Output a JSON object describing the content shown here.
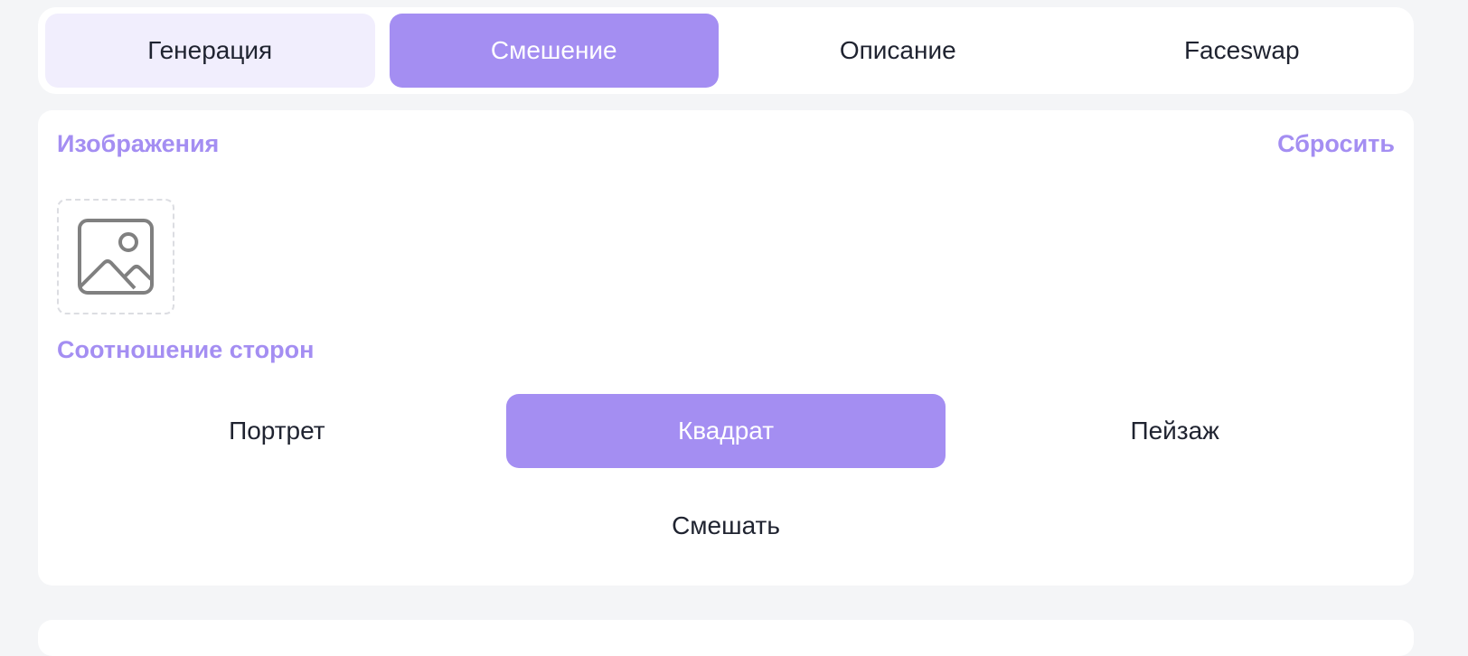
{
  "tabs": [
    {
      "label": "Генерация",
      "state": "light"
    },
    {
      "label": "Смешение",
      "state": "active"
    },
    {
      "label": "Описание",
      "state": "normal"
    },
    {
      "label": "Faceswap",
      "state": "normal"
    }
  ],
  "images": {
    "label": "Изображения",
    "reset_label": "Сбросить",
    "slot_icon": "image-placeholder-icon"
  },
  "aspect": {
    "label": "Соотношение сторон",
    "options": [
      {
        "label": "Портрет",
        "selected": false
      },
      {
        "label": "Квадрат",
        "selected": true
      },
      {
        "label": "Пейзаж",
        "selected": false
      }
    ]
  },
  "mix_button_label": "Смешать",
  "colors": {
    "accent": "#a48ef2",
    "accent_light": "#f1eefd",
    "background": "#f4f5f7",
    "card": "#ffffff",
    "text": "#1f2330"
  }
}
